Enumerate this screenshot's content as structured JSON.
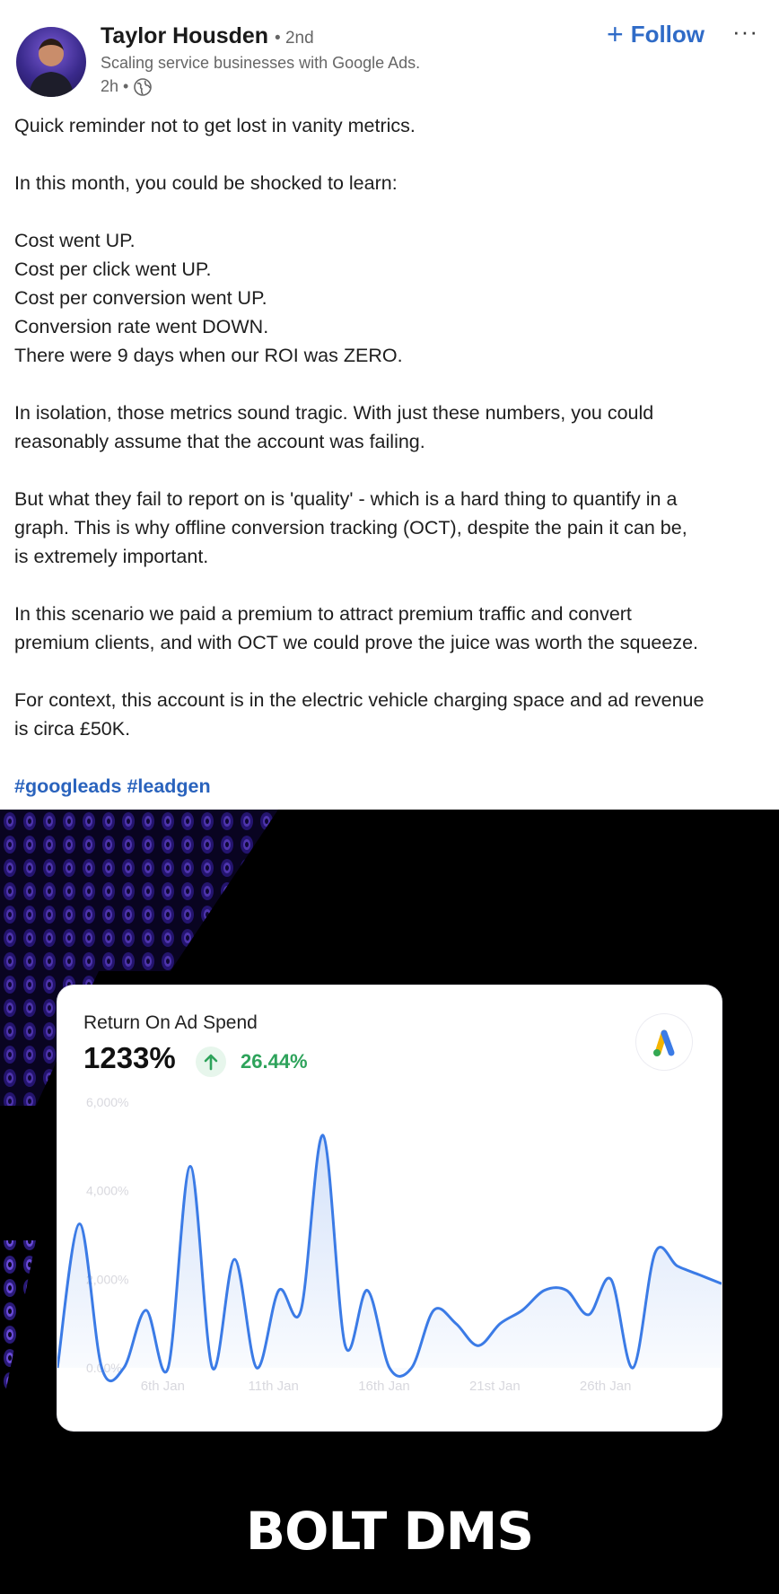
{
  "author": {
    "name": "Taylor Housden",
    "degree": "• 2nd",
    "headline": "Scaling service businesses with Google Ads.",
    "time": "2h •"
  },
  "actions": {
    "follow_label": "Follow",
    "more_label": "···"
  },
  "post": {
    "lines": [
      "Quick reminder not to get lost in vanity metrics.",
      "",
      "In this month, you could be shocked to learn:",
      "",
      "Cost went UP.",
      "Cost per click went UP.",
      "Cost per conversion went UP.",
      "Conversion rate went DOWN.",
      "There were 9 days when our ROI was ZERO.",
      "",
      "In isolation, those metrics sound tragic. With just these numbers, you could",
      "reasonably assume that the account was failing.",
      "",
      "But what they fail to report on is 'quality' - which is a hard thing to quantify in a",
      "graph. This is why offline conversion tracking (OCT), despite the pain it can be,",
      "is extremely important.",
      "",
      "In this scenario we paid a premium to attract premium traffic and convert",
      "premium clients, and with OCT we could prove the juice was worth the squeeze.",
      "",
      "For context, this account is in the electric vehicle charging space and ad revenue",
      "is circa £50K.",
      ""
    ],
    "hashtags": "#googleads #leadgen"
  },
  "card": {
    "title": "Return On Ad Spend",
    "value": "1233%",
    "change": "26.44%",
    "change_color": "#2ea35b"
  },
  "brand": "BOLT DMS",
  "chart_data": {
    "type": "area",
    "title": "Return On Ad Spend",
    "x_ticks": [
      "6th Jan",
      "11th Jan",
      "16th Jan",
      "21st Jan",
      "26th Jan"
    ],
    "y_ticks": [
      "0.00%",
      "2,000%",
      "4,000%",
      "6,000%"
    ],
    "ylim": [
      0,
      6000
    ],
    "days": [
      1,
      2,
      3,
      4,
      5,
      6,
      7,
      8,
      9,
      10,
      11,
      12,
      13,
      14,
      15,
      16,
      17,
      18,
      19,
      20,
      21,
      22,
      23,
      24,
      25,
      26,
      27,
      28,
      29,
      30,
      31
    ],
    "values": [
      0,
      3250,
      0,
      0,
      1300,
      0,
      4550,
      0,
      2450,
      0,
      1750,
      1300,
      5250,
      500,
      1750,
      0,
      0,
      1300,
      1000,
      500,
      1000,
      1300,
      1750,
      1750,
      1200,
      2000,
      0,
      2600,
      2300,
      2100,
      1900
    ],
    "line_color": "#3b7be6",
    "grid": false
  }
}
